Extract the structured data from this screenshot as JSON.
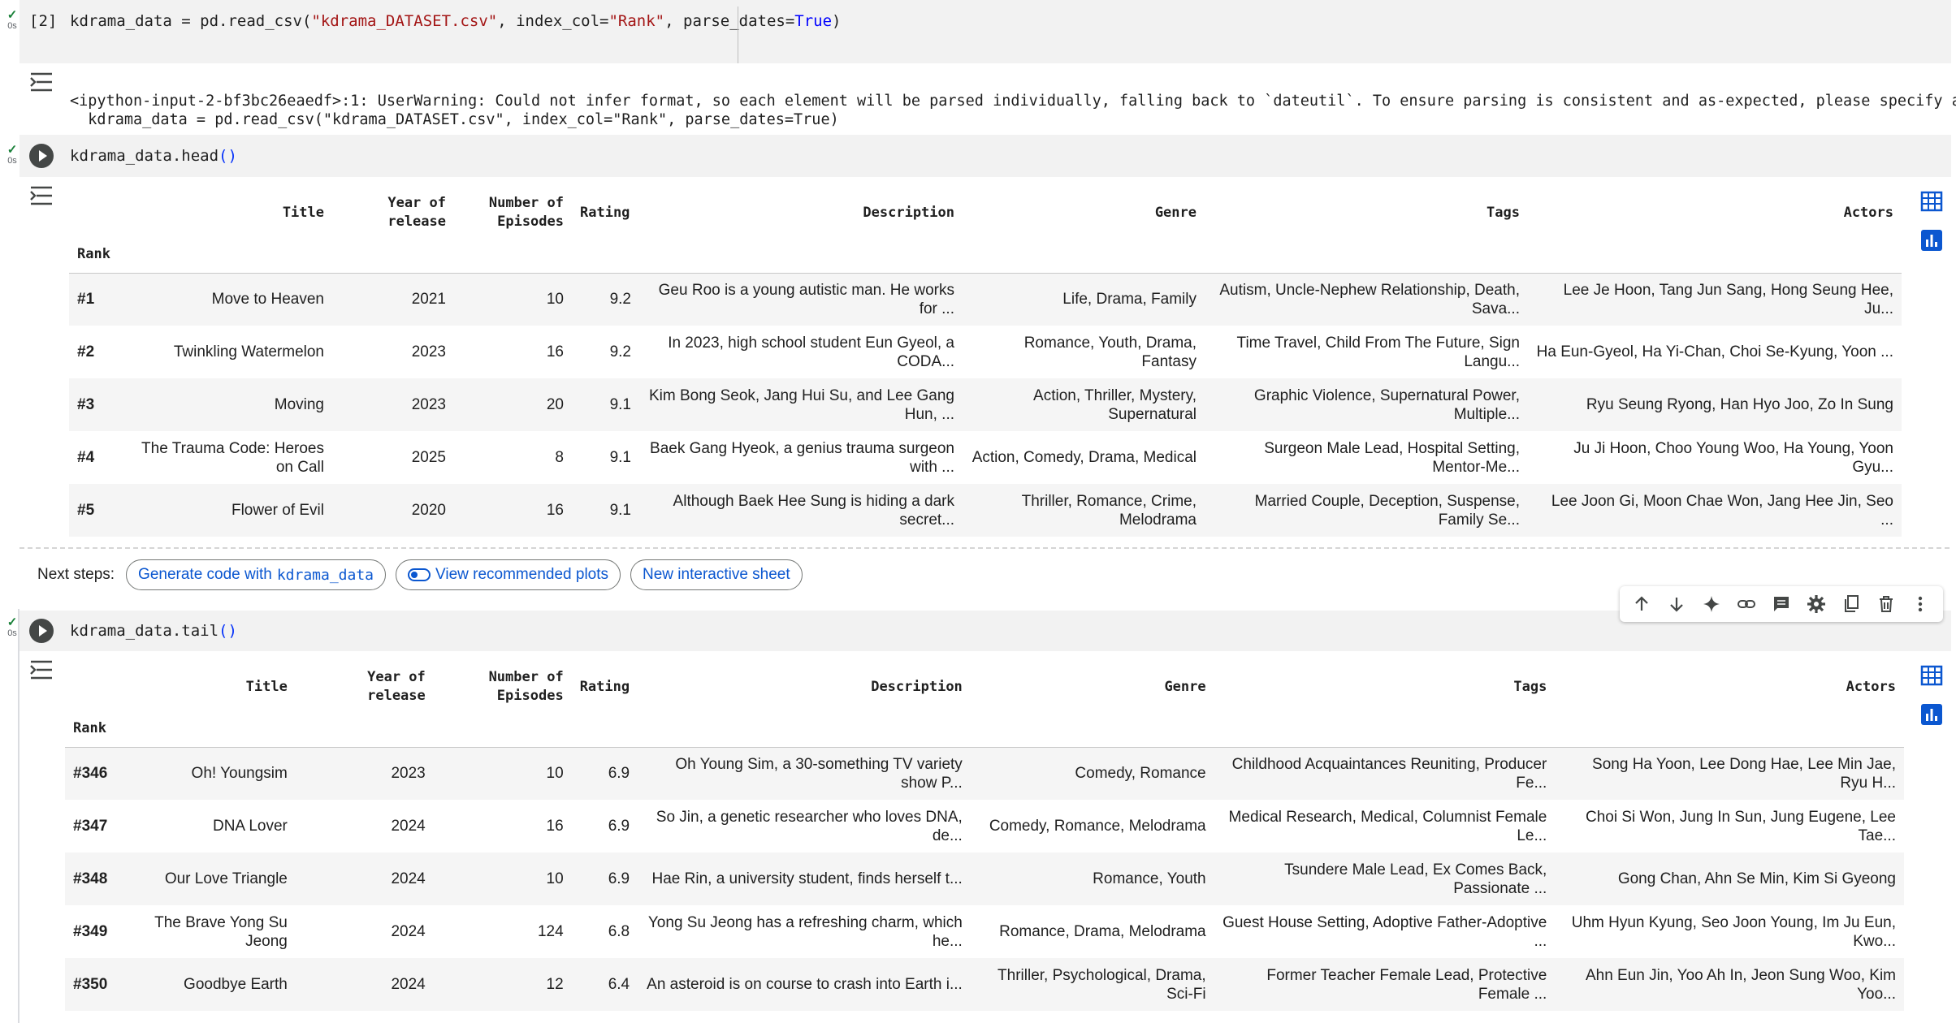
{
  "cells": {
    "cell1": {
      "exec_count": "[2]",
      "status_check": "✓",
      "status_time": "0s",
      "code_prefix": "kdrama_data = pd.read_csv(",
      "code_str1": "\"kdrama_DATASET.csv\"",
      "code_mid": ", index_col=",
      "code_str2": "\"Rank\"",
      "code_mid2": ", parse_dates=",
      "code_kw": "True",
      "code_suffix": ")",
      "warning_line1": "<ipython-input-2-bf3bc26eaedf>:1: UserWarning: Could not infer format, so each element will be parsed individually, falling back to `dateutil`. To ensure parsing is consistent and as-expected, please specify a format.",
      "warning_line2": "  kdrama_data = pd.read_csv(\"kdrama_DATASET.csv\", index_col=\"Rank\", parse_dates=True)"
    },
    "cell2": {
      "status_check": "✓",
      "status_time": "0s",
      "code_prefix": "kdrama_data.head",
      "code_parens": "()"
    },
    "cell3": {
      "status_check": "✓",
      "status_time": "0s",
      "code_prefix": "kdrama_data.tail",
      "code_parens": "()"
    }
  },
  "table_head": {
    "columns": [
      "Title",
      "Year of release",
      "Number of Episodes",
      "Rating",
      "Description",
      "Genre",
      "Tags",
      "Actors"
    ],
    "col_title": "Title",
    "col_year_1": "Year of",
    "col_year_2": "release",
    "col_eps_1": "Number of",
    "col_eps_2": "Episodes",
    "col_rating": "Rating",
    "col_desc": "Description",
    "col_genre": "Genre",
    "col_tags": "Tags",
    "col_actors": "Actors",
    "index_name": "Rank",
    "rows": [
      {
        "rank": "#1",
        "title": "Move to Heaven",
        "year": "2021",
        "episodes": "10",
        "rating": "9.2",
        "description": "Geu Roo is a young autistic man. He works for ...",
        "genre": "Life, Drama, Family",
        "tags": "Autism, Uncle-Nephew Relationship, Death, Sava...",
        "actors": "Lee Je Hoon, Tang Jun Sang, Hong Seung Hee, Ju..."
      },
      {
        "rank": "#2",
        "title": "Twinkling Watermelon",
        "year": "2023",
        "episodes": "16",
        "rating": "9.2",
        "description": "In 2023, high school student Eun Gyeol, a CODA...",
        "genre": "Romance, Youth, Drama, Fantasy",
        "tags": "Time Travel, Child From The Future, Sign Langu...",
        "actors": "Ha Eun-Gyeol, Ha Yi-Chan, Choi Se-Kyung, Yoon ..."
      },
      {
        "rank": "#3",
        "title": "Moving",
        "year": "2023",
        "episodes": "20",
        "rating": "9.1",
        "description": "Kim Bong Seok, Jang Hui Su, and Lee Gang Hun, ...",
        "genre": "Action, Thriller, Mystery, Supernatural",
        "tags": "Graphic Violence, Supernatural Power, Multiple...",
        "actors": "Ryu Seung Ryong, Han Hyo Joo, Zo In Sung"
      },
      {
        "rank": "#4",
        "title": "The Trauma Code: Heroes on Call",
        "year": "2025",
        "episodes": "8",
        "rating": "9.1",
        "description": "Baek Gang Hyeok, a genius trauma surgeon with ...",
        "genre": "Action, Comedy, Drama, Medical",
        "tags": "Surgeon Male Lead, Hospital Setting, Mentor-Me...",
        "actors": "Ju Ji Hoon, Choo Young Woo, Ha Young, Yoon Gyu..."
      },
      {
        "rank": "#5",
        "title": "Flower of Evil",
        "year": "2020",
        "episodes": "16",
        "rating": "9.1",
        "description": "Although Baek Hee Sung is hiding a dark secret...",
        "genre": "Thriller, Romance, Crime, Melodrama",
        "tags": "Married Couple, Deception, Suspense, Family Se...",
        "actors": "Lee Joon Gi, Moon Chae Won, Jang Hee Jin, Seo ..."
      }
    ]
  },
  "table_tail": {
    "col_title": "Title",
    "col_year_1": "Year of",
    "col_year_2": "release",
    "col_eps_1": "Number of",
    "col_eps_2": "Episodes",
    "col_rating": "Rating",
    "col_desc": "Description",
    "col_genre": "Genre",
    "col_tags": "Tags",
    "col_actors": "Actors",
    "index_name": "Rank",
    "rows": [
      {
        "rank": "#346",
        "title": "Oh! Youngsim",
        "year": "2023",
        "episodes": "10",
        "rating": "6.9",
        "description": "Oh Young Sim, a 30-something TV variety show P...",
        "genre": "Comedy, Romance",
        "tags": "Childhood Acquaintances Reuniting, Producer Fe...",
        "actors": "Song Ha Yoon, Lee Dong Hae, Lee Min Jae, Ryu H..."
      },
      {
        "rank": "#347",
        "title": "DNA Lover",
        "year": "2024",
        "episodes": "16",
        "rating": "6.9",
        "description": "So Jin, a genetic researcher who loves DNA, de...",
        "genre": "Comedy, Romance, Melodrama",
        "tags": "Medical Research, Medical, Columnist Female Le...",
        "actors": "Choi Si Won, Jung In Sun, Jung Eugene, Lee Tae..."
      },
      {
        "rank": "#348",
        "title": "Our Love Triangle",
        "year": "2024",
        "episodes": "10",
        "rating": "6.9",
        "description": "Hae Rin, a university student, finds herself t...",
        "genre": "Romance, Youth",
        "tags": "Tsundere Male Lead, Ex Comes Back, Passionate ...",
        "actors": "Gong Chan, Ahn Se Min, Kim Si Gyeong"
      },
      {
        "rank": "#349",
        "title": "The Brave Yong Su Jeong",
        "year": "2024",
        "episodes": "124",
        "rating": "6.8",
        "description": "Yong Su Jeong has a refreshing charm, which he...",
        "genre": "Romance, Drama, Melodrama",
        "tags": "Guest House Setting, Adoptive Father-Adoptive ...",
        "actors": "Uhm Hyun Kyung, Seo Joon Young, Im Ju Eun, Kwo..."
      },
      {
        "rank": "#350",
        "title": "Goodbye Earth",
        "year": "2024",
        "episodes": "12",
        "rating": "6.4",
        "description": "An asteroid is on course to crash into Earth i...",
        "genre": "Thriller, Psychological, Drama, Sci-Fi",
        "tags": "Former Teacher Female Lead, Protective Female ...",
        "actors": "Ahn Eun Jin, Yoo Ah In, Jeon Sung Woo, Kim Yoo..."
      }
    ]
  },
  "next_steps": {
    "label": "Next steps:",
    "chip1_text": "Generate code with ",
    "chip1_code": "kdrama_data",
    "chip2_text": "View recommended plots",
    "chip3_text": "New interactive sheet"
  },
  "toolbar": {
    "icons": [
      "arrow-up-icon",
      "arrow-down-icon",
      "sparkle-icon",
      "link-icon",
      "comment-icon",
      "gear-icon",
      "mirror-cell-icon",
      "delete-icon",
      "more-vert-icon"
    ]
  },
  "colors": {
    "accent_blue": "#0b57d0",
    "check_green": "#188038",
    "code_bg": "#f2f2f2",
    "row_stripe": "#f5f5f5"
  }
}
